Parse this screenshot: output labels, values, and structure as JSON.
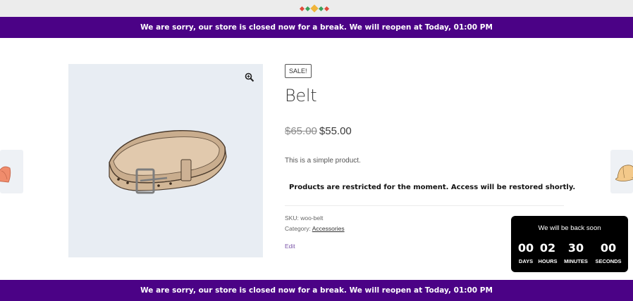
{
  "colors": {
    "banner": "#4b0286",
    "countdown_bg": "#000000",
    "edit_link": "#7b56a8"
  },
  "banner": {
    "message": "We are sorry, our store is closed now for a break. We will reopen at Today, 01:00 PM"
  },
  "product": {
    "badge": "SALE!",
    "title": "Belt",
    "old_price": "$65.00",
    "price": "$55.00",
    "short_description": "This is a simple product.",
    "restriction_notice": "Products are restricted for the moment. Access will be restored shortly.",
    "sku_label": "SKU: ",
    "sku": "woo-belt",
    "category_label": "Category: ",
    "category": "Accessories",
    "edit_label": "Edit",
    "zoom_icon": "magnifier-plus-icon"
  },
  "countdown": {
    "title": "We will be back soon",
    "units": [
      {
        "value": "00",
        "label": "DAYS"
      },
      {
        "value": "02",
        "label": "HOURS"
      },
      {
        "value": "30",
        "label": "MINUTES"
      },
      {
        "value": "00",
        "label": "SECONDS"
      }
    ]
  }
}
